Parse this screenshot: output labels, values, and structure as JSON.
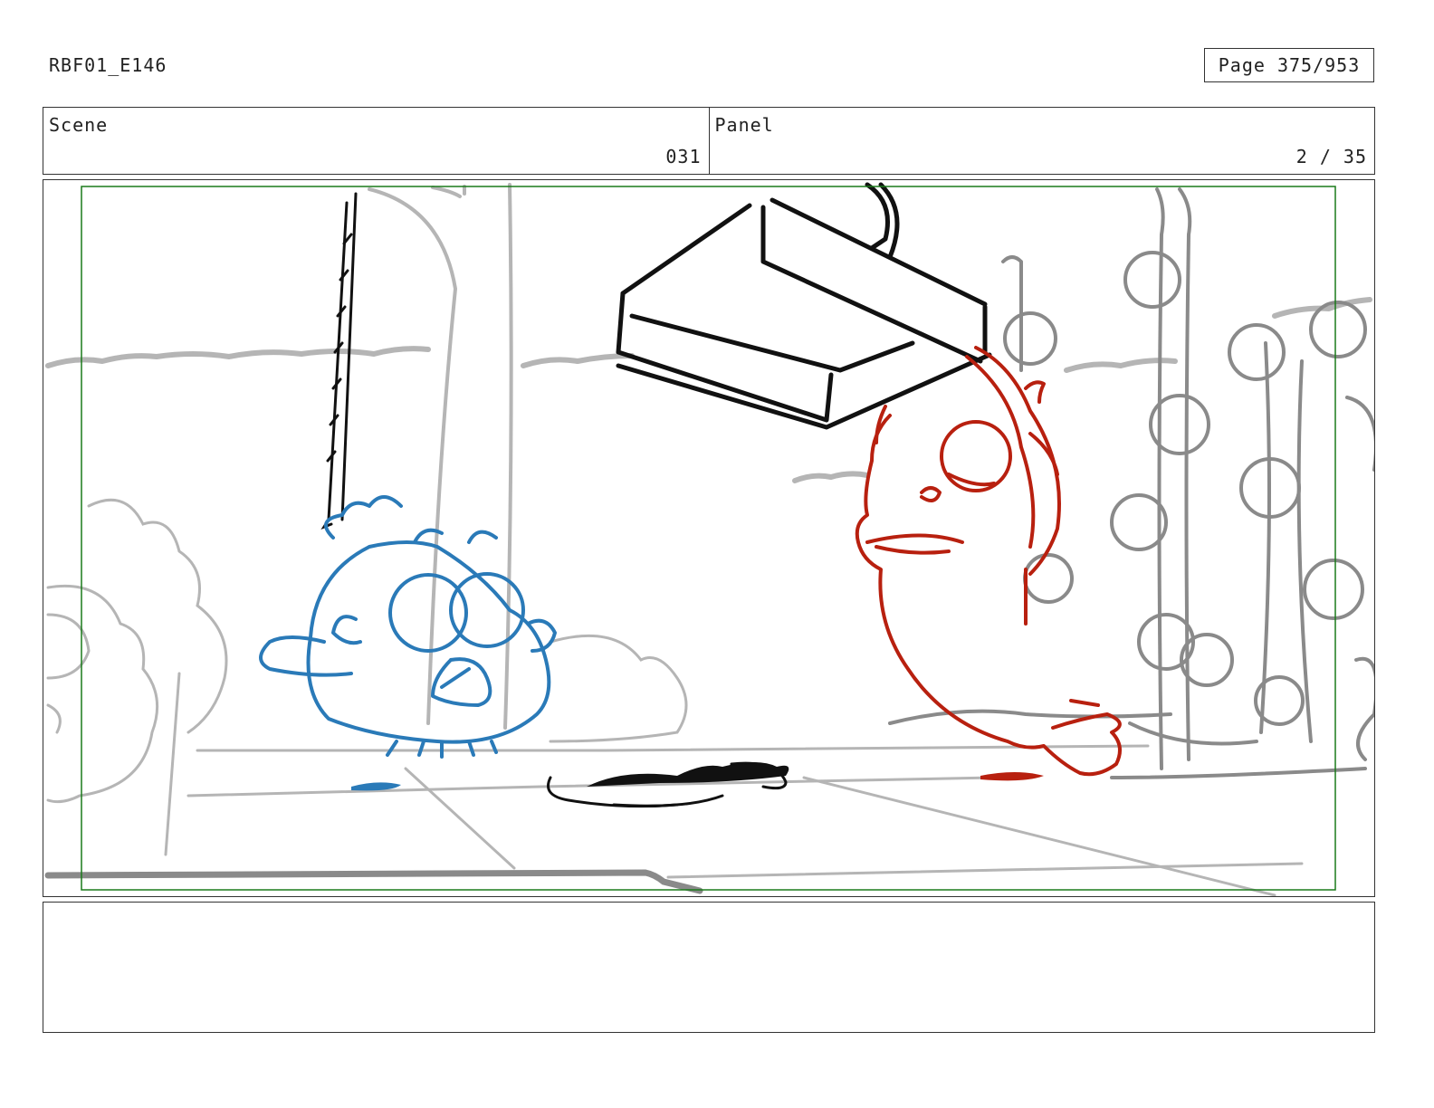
{
  "header": {
    "doc_id": "RBF01_E146",
    "page_label": "Page 375/953"
  },
  "info": {
    "scene_label": "Scene",
    "scene_value": "031",
    "panel_label": "Panel",
    "panel_value": "2 / 35"
  },
  "colors": {
    "frame_border": "#333333",
    "safe_area": "#1a7a1a",
    "background_sketch": "#b5b5b5",
    "midground_sketch": "#8a8a8a",
    "blue_character": "#2a7ab8",
    "red_character": "#b8200f",
    "ink": "#111111"
  },
  "notes": {
    "text": ""
  }
}
